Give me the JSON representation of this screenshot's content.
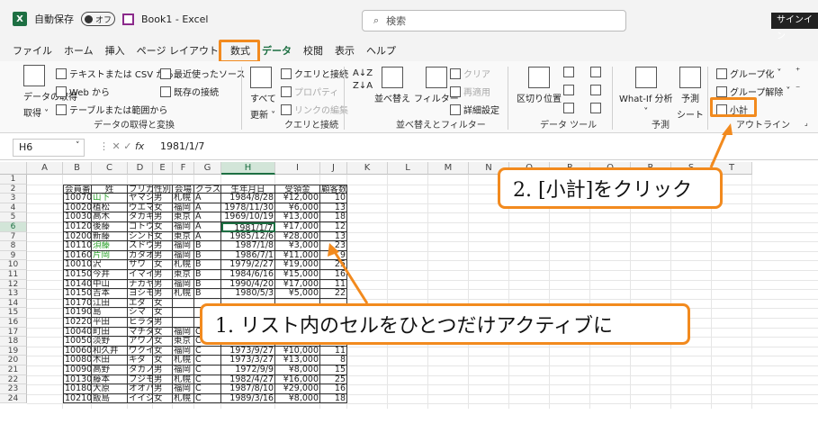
{
  "titlebar": {
    "autosave": "自動保存",
    "toggle": "オフ",
    "book": "Book1 - Excel",
    "search": "検索",
    "signin": "サインイン"
  },
  "menu": [
    "ファイル",
    "ホーム",
    "挿入",
    "ページ レイアウト",
    "数式",
    "データ",
    "校閲",
    "表示",
    "ヘルプ"
  ],
  "ribbon": {
    "get_data": "データの取得",
    "get_data_sub": "取得 ˅",
    "text_csv": "テキストまたは CSV から",
    "web": "Web から",
    "table_range": "テーブルまたは範囲から",
    "recent": "最近使ったソース",
    "existing": "既存の接続",
    "group1": "データの取得と変換",
    "refresh_all": "すべて",
    "refresh_all2": "更新 ˅",
    "queries": "クエリと接続",
    "properties": "プロパティ",
    "edit_links": "リンクの編集",
    "group2": "クエリと接続",
    "sort": "並べ替え",
    "filter": "フィルター",
    "clear": "クリア",
    "reapply": "再適用",
    "advanced": "詳細設定",
    "group3": "並べ替えとフィルター",
    "text_to_col": "区切り位置",
    "group4": "データ ツール",
    "whatif": "What-If 分析",
    "forecast": "予測",
    "forecast2": "シート",
    "group5": "予測",
    "grp": "グループ化",
    "ungrp": "グループ解除",
    "subtotal": "小計",
    "group6": "アウトライン"
  },
  "formula": {
    "cell": "H6",
    "value": "1981/1/7"
  },
  "columns": [
    "A",
    "B",
    "C",
    "D",
    "E",
    "F",
    "G",
    "H",
    "I",
    "J",
    "K",
    "L",
    "M",
    "N",
    "O",
    "P",
    "Q",
    "R",
    "S",
    "T"
  ],
  "rows": [
    "1",
    "2",
    "3",
    "4",
    "5",
    "6",
    "7",
    "8",
    "9",
    "10",
    "11",
    "12",
    "13",
    "14",
    "15",
    "16",
    "17",
    "18",
    "19",
    "20",
    "21",
    "22",
    "23",
    "24"
  ],
  "headers": [
    "会員番号",
    "姓",
    "フリガナ",
    "性別",
    "会場",
    "クラス",
    "生年月日",
    "受領金",
    "顧客数"
  ],
  "table": [
    [
      "10070",
      "山下",
      "ヤマシタ",
      "男",
      "札幌",
      "A",
      "1984/8/28",
      "¥12,000",
      "10"
    ],
    [
      "10020",
      "植松",
      "ウエマツ",
      "女",
      "福岡",
      "A",
      "1978/11/30",
      "¥6,000",
      "13"
    ],
    [
      "10030",
      "高木",
      "タカギ",
      "男",
      "東京",
      "A",
      "1969/10/19",
      "¥13,000",
      "18"
    ],
    [
      "10120",
      "後藤",
      "ゴトウ",
      "女",
      "福岡",
      "A",
      "1981/1/7",
      "¥17,000",
      "12"
    ],
    [
      "10200",
      "新藤",
      "シンドウ",
      "女",
      "東京",
      "A",
      "1985/12/6",
      "¥28,000",
      "13"
    ],
    [
      "10110",
      "須藤",
      "スドウ",
      "男",
      "福岡",
      "B",
      "1987/1/8",
      "¥3,000",
      "23"
    ],
    [
      "10160",
      "片岡",
      "カタオカ",
      "男",
      "福岡",
      "B",
      "1986/7/1",
      "¥11,000",
      "9"
    ],
    [
      "10010",
      "沢",
      "サワ",
      "女",
      "札幌",
      "B",
      "1979/2/27",
      "¥19,000",
      "25"
    ],
    [
      "10150",
      "今井",
      "イマイ",
      "男",
      "東京",
      "B",
      "1984/6/16",
      "¥15,000",
      "16"
    ],
    [
      "10140",
      "中山",
      "ナカヤマ",
      "男",
      "福岡",
      "B",
      "1990/4/20",
      "¥17,000",
      "11"
    ],
    [
      "10150",
      "吉本",
      "ヨシモト",
      "男",
      "札幌",
      "B",
      "1980/5/3",
      "¥5,000",
      "22"
    ],
    [
      "10170",
      "江田",
      "エダ",
      "女",
      "",
      "",
      "",
      "",
      ""
    ],
    [
      "10190",
      "島",
      "シマ",
      "女",
      "",
      "",
      "",
      "",
      ""
    ],
    [
      "10220",
      "平田",
      "ヒラタ",
      "男",
      "",
      "",
      "",
      "",
      ""
    ],
    [
      "10040",
      "町田",
      "マチダ",
      "女",
      "福岡",
      "C",
      "1977/12/27",
      "¥8,000",
      "24"
    ],
    [
      "10050",
      "淡野",
      "アワノ",
      "女",
      "東京",
      "C",
      "1973/8/4",
      "¥29,000",
      "15"
    ],
    [
      "10060",
      "和久井",
      "ワクイ",
      "女",
      "福岡",
      "C",
      "1973/9/27",
      "¥10,000",
      "11"
    ],
    [
      "10080",
      "木田",
      "キダ",
      "女",
      "札幌",
      "C",
      "1973/3/27",
      "¥13,000",
      "8"
    ],
    [
      "10090",
      "高野",
      "タカノ",
      "男",
      "福岡",
      "C",
      "1972/9/9",
      "¥8,000",
      "15"
    ],
    [
      "10130",
      "藤本",
      "フジモト",
      "男",
      "札幌",
      "C",
      "1982/4/27",
      "¥16,000",
      "25"
    ],
    [
      "10180",
      "大原",
      "オオハラ",
      "男",
      "福岡",
      "C",
      "1987/8/10",
      "¥29,000",
      "16"
    ],
    [
      "10210",
      "飯島",
      "イイジマ",
      "女",
      "札幌",
      "C",
      "1989/3/16",
      "¥8,000",
      "18"
    ]
  ],
  "callout1": "1. リスト内のセルをひとつだけアクティブに",
  "callout2": "2. [小計]をクリック",
  "colors": {
    "accent": "#f28a1e",
    "excel_green": "#1d6f42"
  }
}
